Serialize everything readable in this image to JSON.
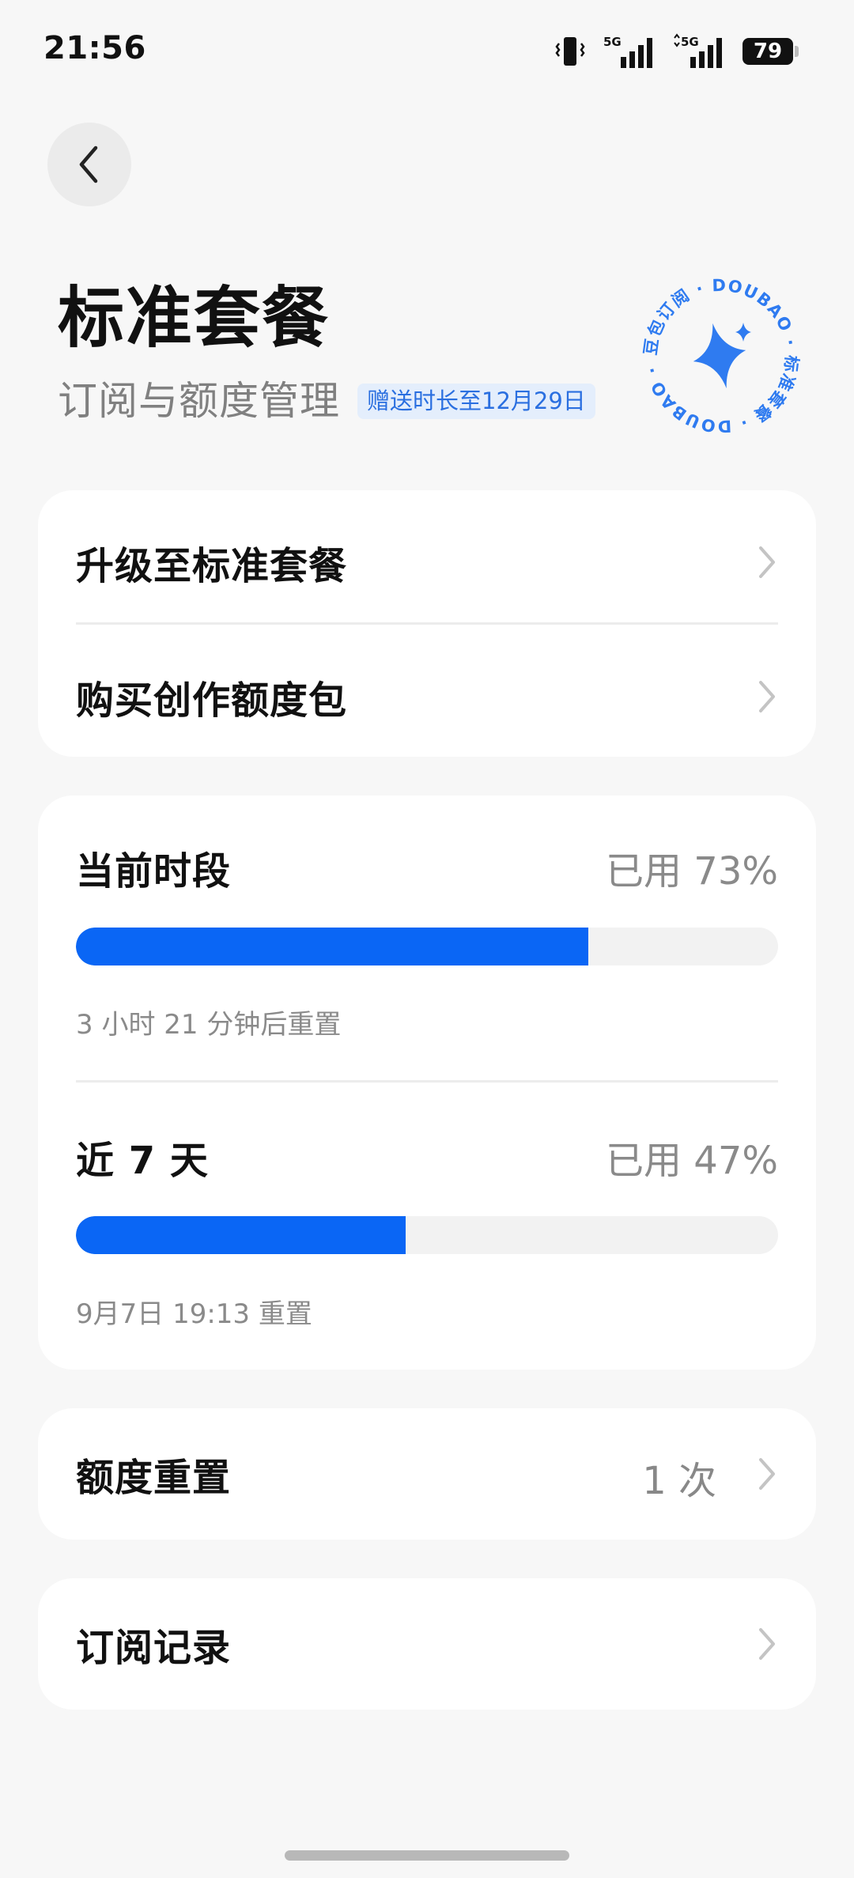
{
  "status_bar": {
    "time": "21:56",
    "network_1": "5G",
    "network_2": "5G",
    "battery": "79"
  },
  "header": {
    "title": "标准套餐",
    "subtitle": "订阅与额度管理",
    "badge": "赠送时长至12月29日",
    "seal_ring_text": "豆包订阅 · DOUBAO · 标准套餐 · DOUBAO ·",
    "seal_text_1": "豆包订阅",
    "seal_text_2": "DOUBAO",
    "seal_text_3": "标准套餐",
    "seal_text_4": "DOUBAO"
  },
  "actions": {
    "upgrade_label": "升级至标准套餐",
    "buy_label": "购买创作额度包"
  },
  "usage": {
    "current": {
      "label": "当前时段",
      "value": "已用 73%",
      "percent": 73,
      "note": "3 小时 21 分钟后重置"
    },
    "week": {
      "label": "近 7 天",
      "value": "已用 47%",
      "percent": 47,
      "note": "9月7日 19:13 重置"
    }
  },
  "quota_reset": {
    "label": "额度重置",
    "value": "1 次"
  },
  "history": {
    "label": "订阅记录"
  },
  "colors": {
    "accent": "#0a66f5",
    "badge_bg": "#e4eefc",
    "badge_text": "#2a6fe0",
    "seal": "#2f7bf0"
  },
  "icons": {
    "back": "chevron-left-icon",
    "row_chevron": "chevron-right-icon",
    "seal_star": "sparkle-icon",
    "vibrate": "vibrate-icon",
    "signal": "signal-icon"
  }
}
